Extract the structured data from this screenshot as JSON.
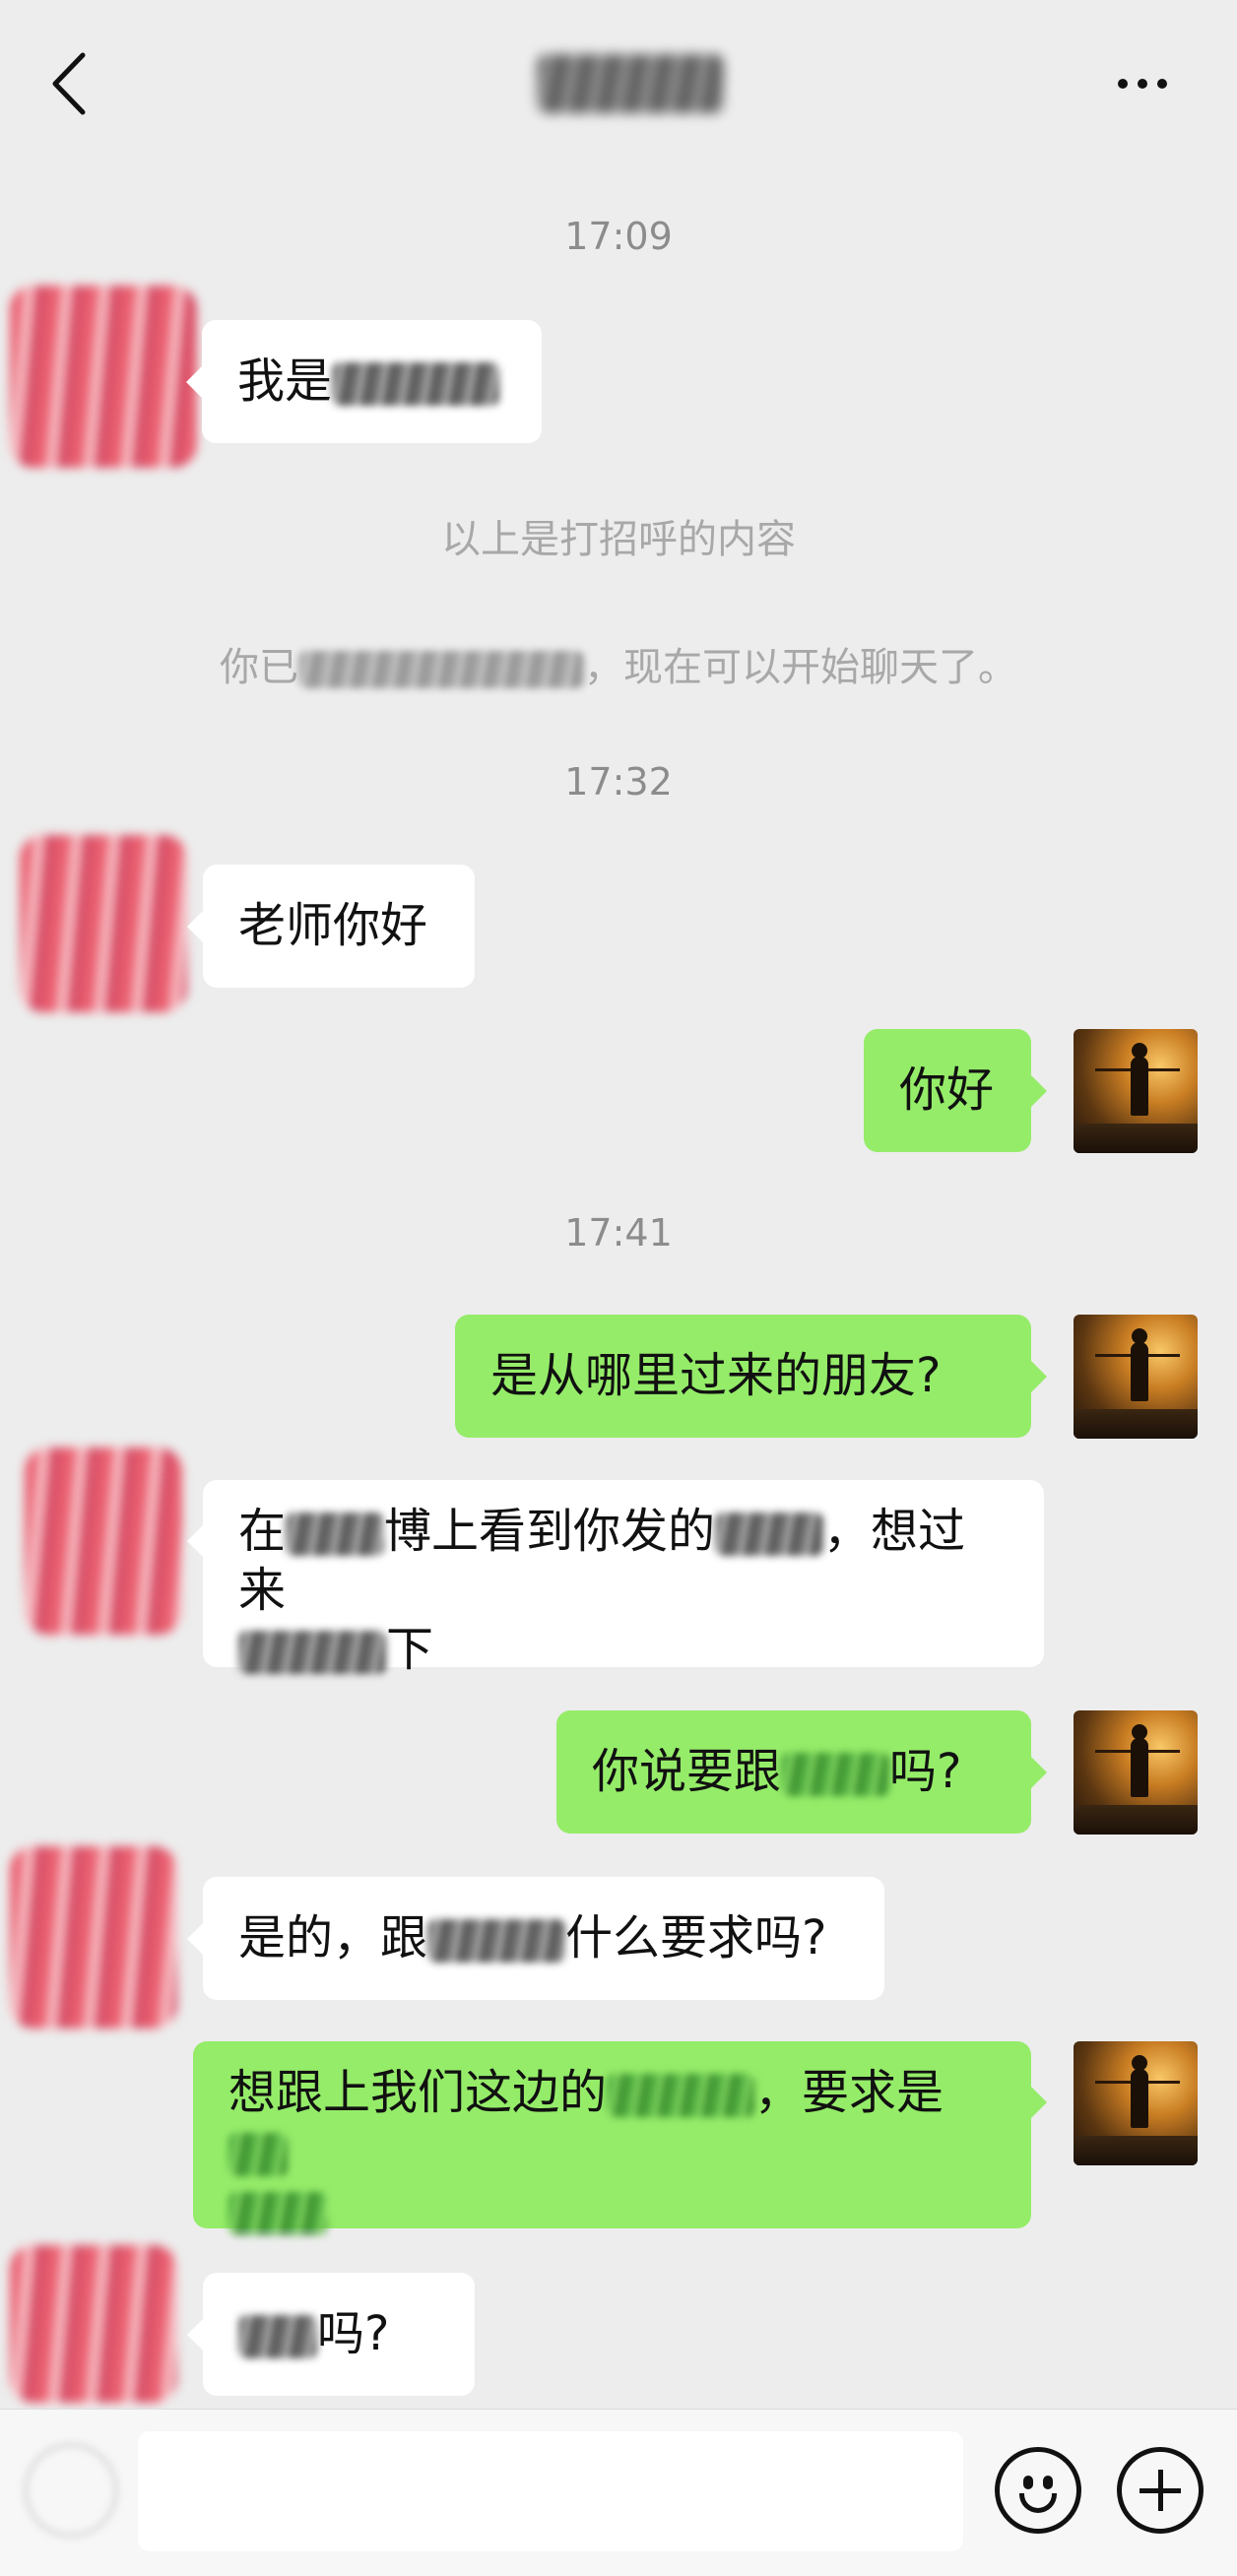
{
  "header": {
    "back_icon": "chevron-left-icon",
    "more_icon": "ellipsis-icon"
  },
  "messages": {
    "time1": "17:09",
    "m1_prefix": "我是",
    "sys_greeting": "以上是打招呼的内容",
    "sys_added_prefix": "你已",
    "sys_added_suffix": "，现在可以开始聊天了。",
    "time2": "17:32",
    "m2": "老师你好",
    "m3": "你好",
    "time3": "17:41",
    "m4": "是从哪里过来的朋友?",
    "m5_a": "在",
    "m5_b": "博上看到你发的",
    "m5_c": "，想过来",
    "m5_d": "下",
    "m6_prefix": "你说要跟",
    "m6_suffix": "吗?",
    "m7_prefix": "是的，跟",
    "m7_suffix": "什么要求吗?",
    "m8_prefix": "想跟上我们这边的",
    "m8_mid": "，要求是",
    "m9_suffix": "吗?"
  },
  "input_bar": {
    "voice_icon": "voice-icon",
    "emoji_icon": "emoji-icon",
    "plus_icon": "plus-circle-icon",
    "placeholder": ""
  },
  "colors": {
    "background": "#ededed",
    "bubble_out": "#95ec69",
    "bubble_in": "#ffffff",
    "system_text": "#a8a8a8"
  }
}
